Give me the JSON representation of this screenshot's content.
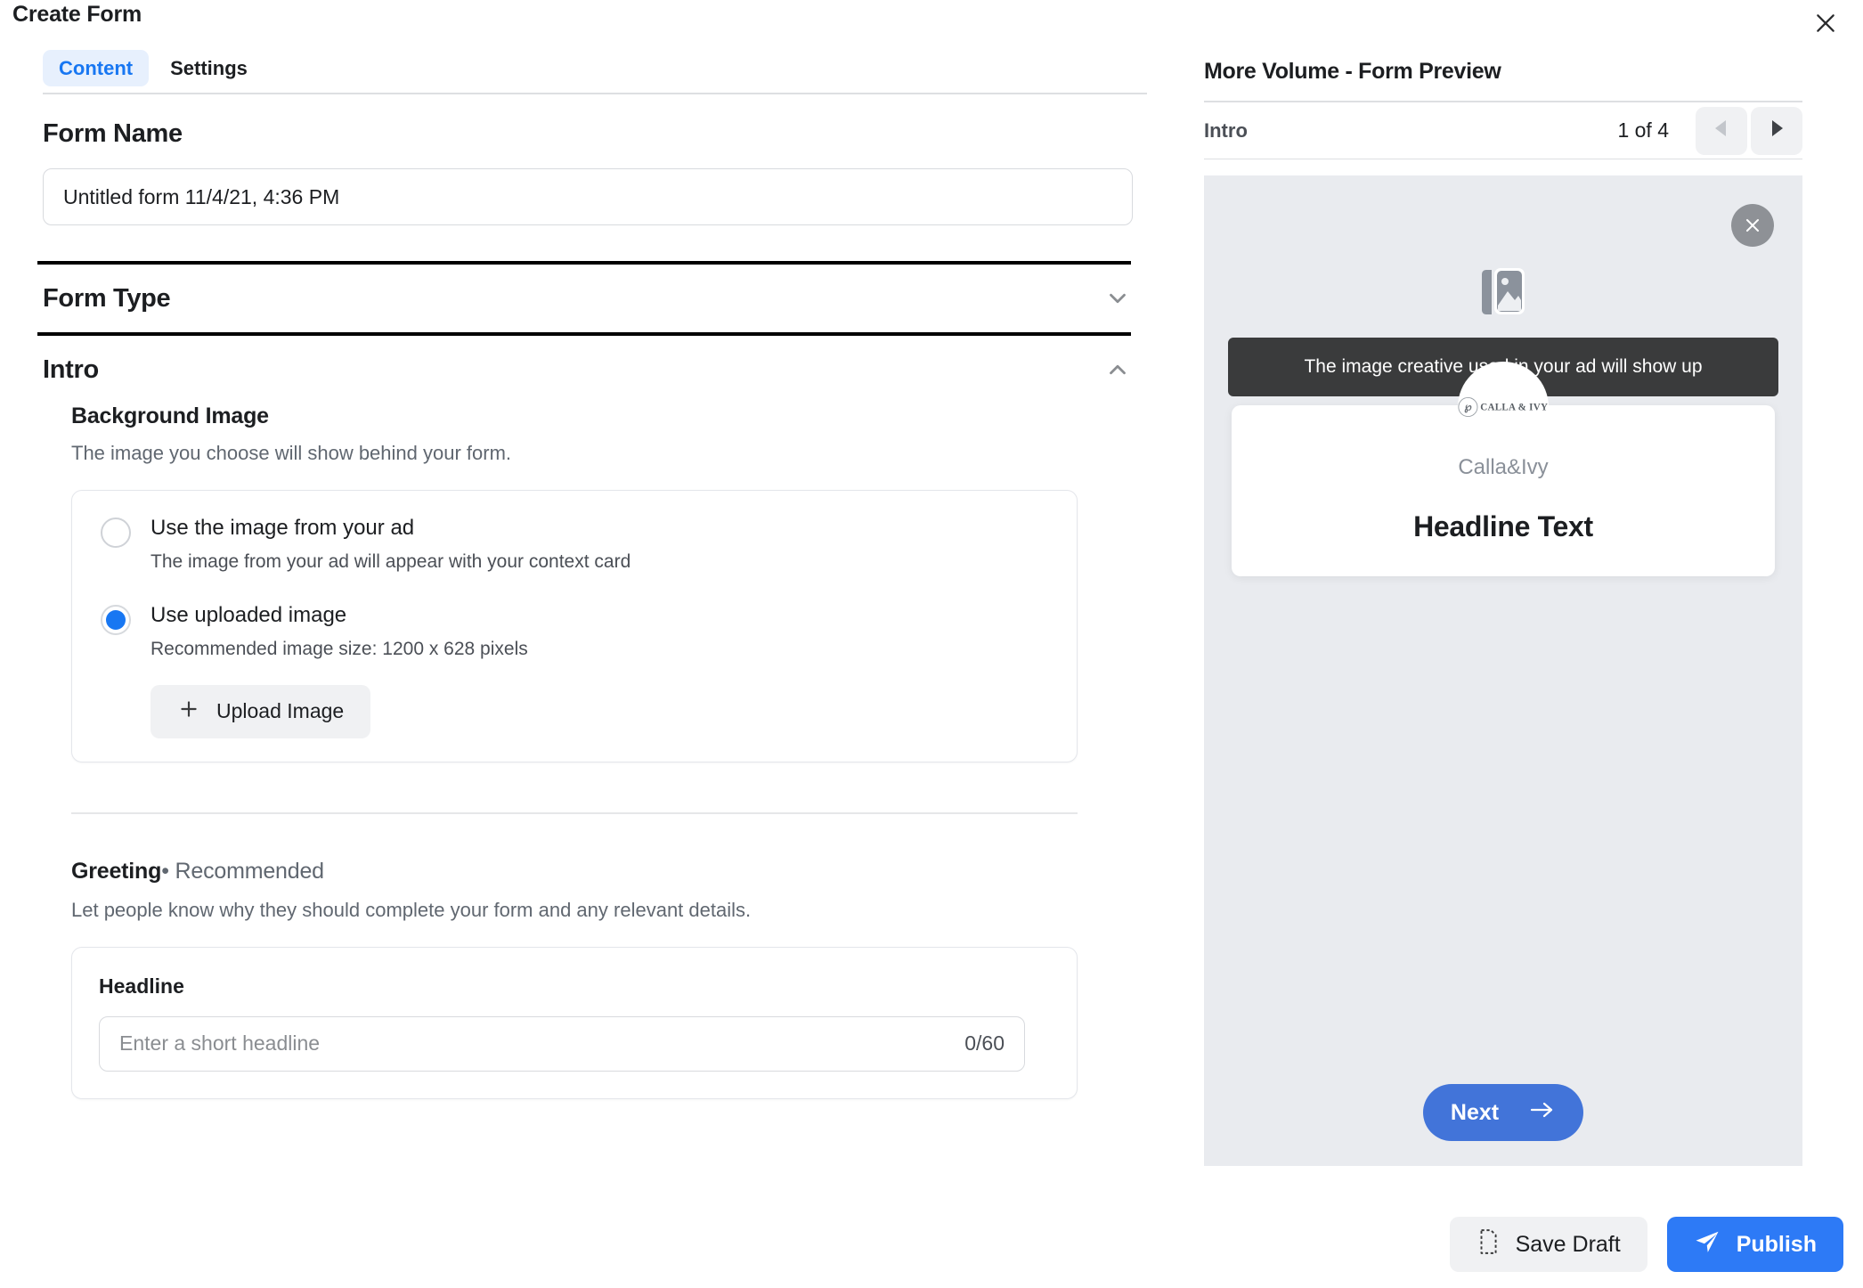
{
  "dialog": {
    "title": "Create Form",
    "close_icon": "close-icon"
  },
  "tabs": [
    {
      "label": "Content",
      "active": true
    },
    {
      "label": "Settings",
      "active": false
    }
  ],
  "form_name": {
    "heading": "Form Name",
    "value": "Untitled form 11/4/21, 4:36 PM"
  },
  "sections": {
    "form_type": {
      "label": "Form Type",
      "chevron": "chevron-down-icon"
    },
    "intro": {
      "label": "Intro",
      "chevron": "chevron-up-icon"
    }
  },
  "background_image": {
    "heading": "Background Image",
    "description": "The image you choose will show behind your form.",
    "options": [
      {
        "label": "Use the image from your ad",
        "sublabel": "The image from your ad will appear with your context card",
        "checked": false
      },
      {
        "label": "Use uploaded image",
        "sublabel": "Recommended image size: 1200 x 628 pixels",
        "checked": true
      }
    ],
    "upload_button": "Upload Image",
    "upload_icon": "plus-icon"
  },
  "greeting": {
    "label": "Greeting",
    "separator": "•",
    "recommended": "Recommended",
    "description": "Let people know why they should complete your form and any relevant details.",
    "headline_field": {
      "label": "Headline",
      "placeholder": "Enter a short headline",
      "counter": "0/60"
    }
  },
  "preview": {
    "title": "More Volume - Form Preview",
    "step_label": "Intro",
    "step_count": "1 of 4",
    "prev_icon": "triangle-left-icon",
    "next_icon": "triangle-right-icon",
    "stage_close_icon": "close-circle-icon",
    "image_placeholder_icon": "photo-stack-icon",
    "tooltip": "The image creative used in your ad will show up",
    "avatar_mark": "℘",
    "avatar_wordmark": "CALLA & IVY",
    "brand_name": "Calla&Ivy",
    "headline_text": "Headline Text",
    "next_button": "Next",
    "next_arrow_icon": "arrow-right-icon"
  },
  "footer": {
    "save_draft": "Save Draft",
    "save_icon": "document-icon",
    "publish": "Publish",
    "publish_icon": "send-icon"
  },
  "colors": {
    "accent_blue": "#1877f2",
    "publish_blue": "#2d7af6",
    "next_blue": "#4274d9",
    "tooltip_dark": "#3a3b3c",
    "stage_gray": "#e9ebef"
  }
}
